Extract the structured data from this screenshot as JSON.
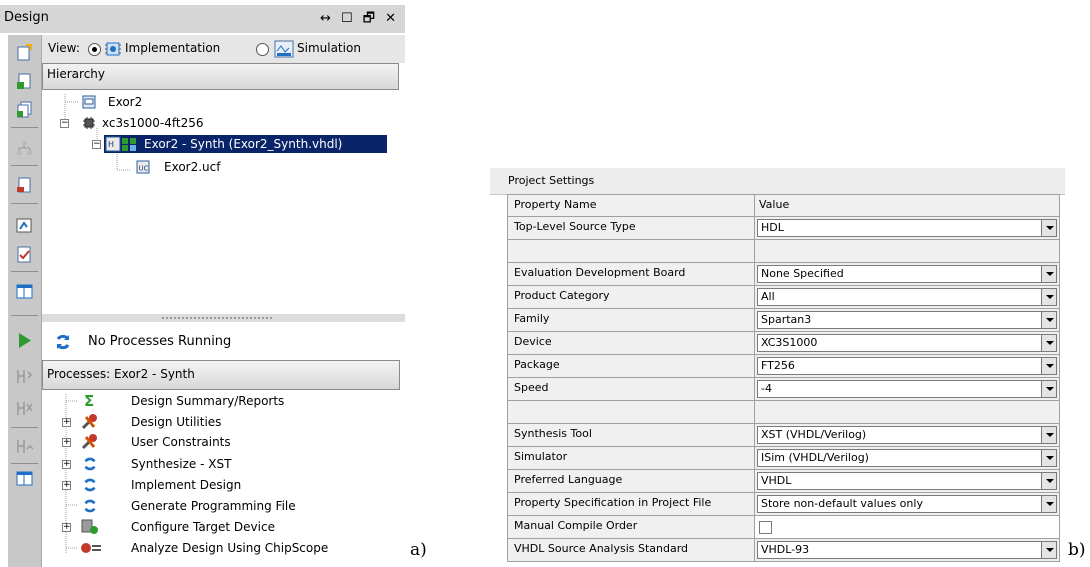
{
  "design_panel": {
    "title": "Design",
    "window_controls": "↔ ☐ 🗗 ✕",
    "view_label": "View:",
    "view_options": [
      {
        "label": "Implementation",
        "selected": true
      },
      {
        "label": "Simulation",
        "selected": false
      }
    ],
    "hierarchy_header": "Hierarchy",
    "tree": [
      {
        "label": "Exor2",
        "icon": "document-icon",
        "level": 0
      },
      {
        "label": "xc3s1000-4ft256",
        "icon": "chip-icon",
        "level": 0,
        "expanded": true
      },
      {
        "label": "Exor2 - Synth (Exor2_Synth.vhdl)",
        "icon": "vhdl-module-icon",
        "level": 1,
        "expanded": true,
        "selected": true
      },
      {
        "label": "Exor2.ucf",
        "icon": "ucf-file-icon",
        "level": 2
      }
    ],
    "process_status": "No Processes Running",
    "processes_header": "Processes: Exor2 - Synth",
    "processes": [
      {
        "label": "Design Summary/Reports",
        "icon": "sigma-icon",
        "expandable": false
      },
      {
        "label": "Design Utilities",
        "icon": "tools-icon",
        "expandable": true
      },
      {
        "label": "User Constraints",
        "icon": "tools-icon",
        "expandable": true
      },
      {
        "label": "Synthesize - XST",
        "icon": "refresh-icon",
        "expandable": true
      },
      {
        "label": "Implement Design",
        "icon": "refresh-icon",
        "expandable": true
      },
      {
        "label": "Generate Programming File",
        "icon": "refresh-icon",
        "expandable": false
      },
      {
        "label": "Configure Target Device",
        "icon": "device-icon",
        "expandable": true
      },
      {
        "label": "Analyze Design Using ChipScope",
        "icon": "chipscope-icon",
        "expandable": false
      }
    ],
    "caption": "a)"
  },
  "project_settings": {
    "title": "Project Settings",
    "header": {
      "name": "Property Name",
      "value": "Value"
    },
    "rows": [
      {
        "name": "Top-Level Source Type",
        "value": "HDL",
        "kind": "select"
      },
      {
        "name": "",
        "value": "",
        "kind": "blank"
      },
      {
        "name": "Evaluation Development Board",
        "value": "None Specified",
        "kind": "select"
      },
      {
        "name": "Product Category",
        "value": "All",
        "kind": "select"
      },
      {
        "name": "Family",
        "value": "Spartan3",
        "kind": "select"
      },
      {
        "name": "Device",
        "value": "XC3S1000",
        "kind": "select"
      },
      {
        "name": "Package",
        "value": "FT256",
        "kind": "select"
      },
      {
        "name": "Speed",
        "value": "-4",
        "kind": "select"
      },
      {
        "name": "",
        "value": "",
        "kind": "blank"
      },
      {
        "name": "Synthesis Tool",
        "value": "XST (VHDL/Verilog)",
        "kind": "select"
      },
      {
        "name": "Simulator",
        "value": "ISim (VHDL/Verilog)",
        "kind": "select"
      },
      {
        "name": "Preferred Language",
        "value": "VHDL",
        "kind": "select"
      },
      {
        "name": "Property Specification in Project File",
        "value": "Store non-default values only",
        "kind": "select"
      },
      {
        "name": "Manual Compile Order",
        "value": "",
        "kind": "checkbox",
        "checked": false
      },
      {
        "name": "VHDL Source Analysis Standard",
        "value": "VHDL-93",
        "kind": "select"
      }
    ],
    "caption": "b)"
  },
  "colors": {
    "selection": "#0a246a",
    "icon_green": "#2e9b2e",
    "icon_blue": "#1f6fc5",
    "icon_red": "#c0392b"
  }
}
